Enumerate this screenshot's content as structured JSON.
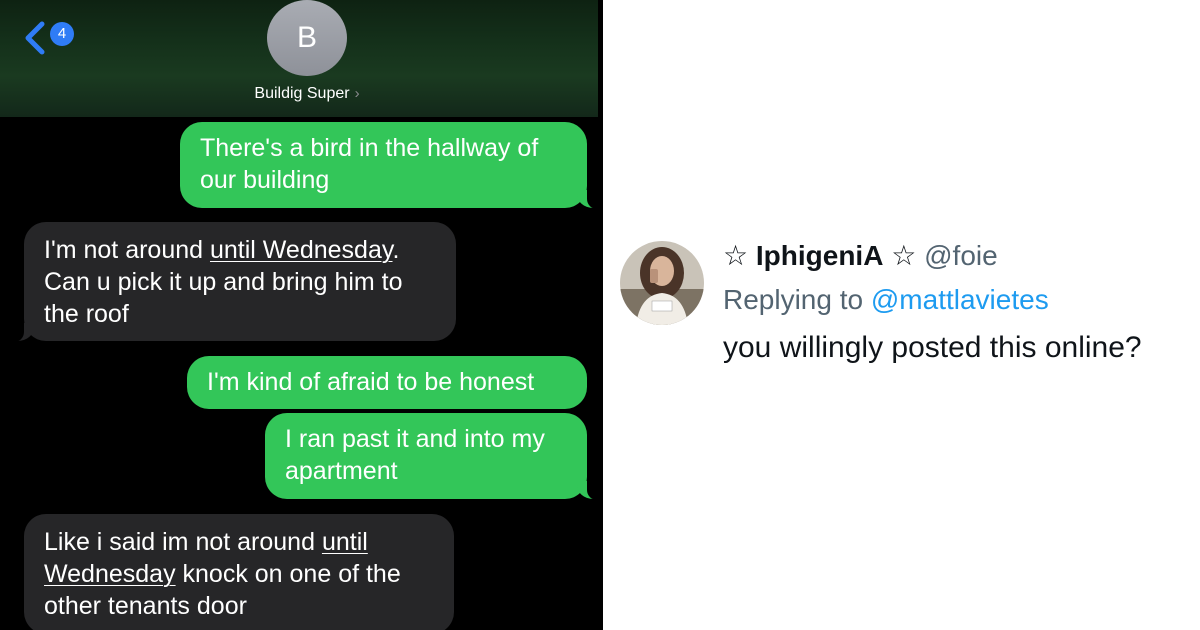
{
  "chat": {
    "back_count": "4",
    "contact_initial": "B",
    "contact_name": "Buildig Super",
    "header_chevron": "›",
    "messages": [
      {
        "from": "me",
        "lines": [
          "There's a bird in the hallway of",
          "our building"
        ]
      },
      {
        "from": "them",
        "line1_pre": "I'm not around ",
        "line1_link": "until Wednesday",
        "line1_post": ".",
        "line2": "Can u pick it up and bring him to",
        "line3": "the roof"
      },
      {
        "from": "me",
        "lines": [
          "I'm kind of afraid to be honest"
        ]
      },
      {
        "from": "me",
        "lines": [
          "I ran past it and into my",
          "apartment"
        ]
      },
      {
        "from": "them",
        "line1_pre": "Like i said im not around ",
        "line1_link": "until",
        "line2_link": "Wednesday",
        "line2_post": " knock on one of the",
        "line3": "other tenants door"
      }
    ],
    "colors": {
      "sent_bubble": "#33c659",
      "received_bubble": "#262628",
      "badge": "#2f7cf6"
    }
  },
  "reply": {
    "star_left": "☆",
    "display_name": "IphigeniA",
    "star_right": "☆",
    "handle": "@foie",
    "replying_prefix": "Replying to ",
    "replying_handle": "@mattlavietes",
    "text": "you willingly posted this online?",
    "colors": {
      "link": "#1d9bf0",
      "muted": "#536471"
    }
  }
}
